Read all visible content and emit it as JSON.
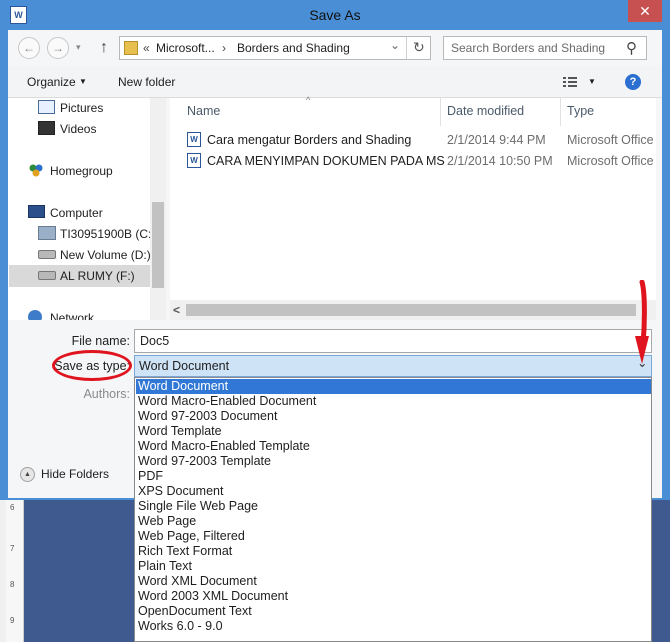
{
  "window": {
    "title": "Save As",
    "close_glyph": "✕",
    "app_icon": "word-icon",
    "app_icon_text": "W"
  },
  "nav": {
    "back_glyph": "←",
    "forward_glyph": "→",
    "up_glyph": "↑",
    "refresh_glyph": "↻",
    "search_glyph": "⚲",
    "breadcrumb": {
      "overflow": "«",
      "parts": [
        "Microsoft...",
        "Borders and Shading"
      ],
      "separator": "›",
      "dropdown_glyph": "⌄"
    },
    "search_placeholder": "Search Borders and Shading"
  },
  "toolbar": {
    "organize": "Organize",
    "organize_glyph": "▼",
    "new_folder": "New folder",
    "view_glyph": "▼",
    "help_glyph": "?"
  },
  "sidebar": {
    "items": [
      {
        "label": "Pictures",
        "icon": "pictures-icon"
      },
      {
        "label": "Videos",
        "icon": "videos-icon"
      },
      {
        "label": "Homegroup",
        "icon": "homegroup-icon"
      },
      {
        "label": "Computer",
        "icon": "computer-icon"
      },
      {
        "label": "TI30951900B (C:)",
        "icon": "drive-icon"
      },
      {
        "label": "New Volume (D:)",
        "icon": "drive-icon"
      },
      {
        "label": "AL RUMY (F:)",
        "icon": "drive-icon"
      },
      {
        "label": "Network",
        "icon": "network-icon"
      }
    ]
  },
  "files": {
    "columns": {
      "name": "Name",
      "date": "Date modified",
      "type": "Type",
      "sort_glyph": "^"
    },
    "rows": [
      {
        "name": "Cara mengatur Borders and Shading",
        "date": "2/1/2014 9:44 PM",
        "type": "Microsoft Office"
      },
      {
        "name": "CARA MENYIMPAN DOKUMEN PADA MS",
        "date": "2/1/2014 10:50 PM",
        "type": "Microsoft Office"
      }
    ],
    "scroll_left_glyph": "<"
  },
  "form": {
    "file_name_label": "File name:",
    "file_name_value": "Doc5",
    "save_type_label": "Save as type:",
    "save_type_value": "Word Document",
    "save_type_glyph": "⌄",
    "authors_label": "Authors:"
  },
  "footer": {
    "hide_folders": "Hide Folders",
    "hide_glyph": "▲"
  },
  "dropdown_options": [
    "Word Document",
    "Word Macro-Enabled Document",
    "Word 97-2003 Document",
    "Word Template",
    "Word Macro-Enabled Template",
    "Word 97-2003 Template",
    "PDF",
    "XPS Document",
    "Single File Web Page",
    "Web Page",
    "Web Page, Filtered",
    "Rich Text Format",
    "Plain Text",
    "Word XML Document",
    "Word 2003 XML Document",
    "OpenDocument Text",
    "Works 6.0 - 9.0"
  ],
  "ruler_marks": [
    "6",
    "7",
    "8",
    "9"
  ],
  "colors": {
    "selection": "#3178d6",
    "frame": "#4a8fd6",
    "annotation": "#e0141e"
  }
}
